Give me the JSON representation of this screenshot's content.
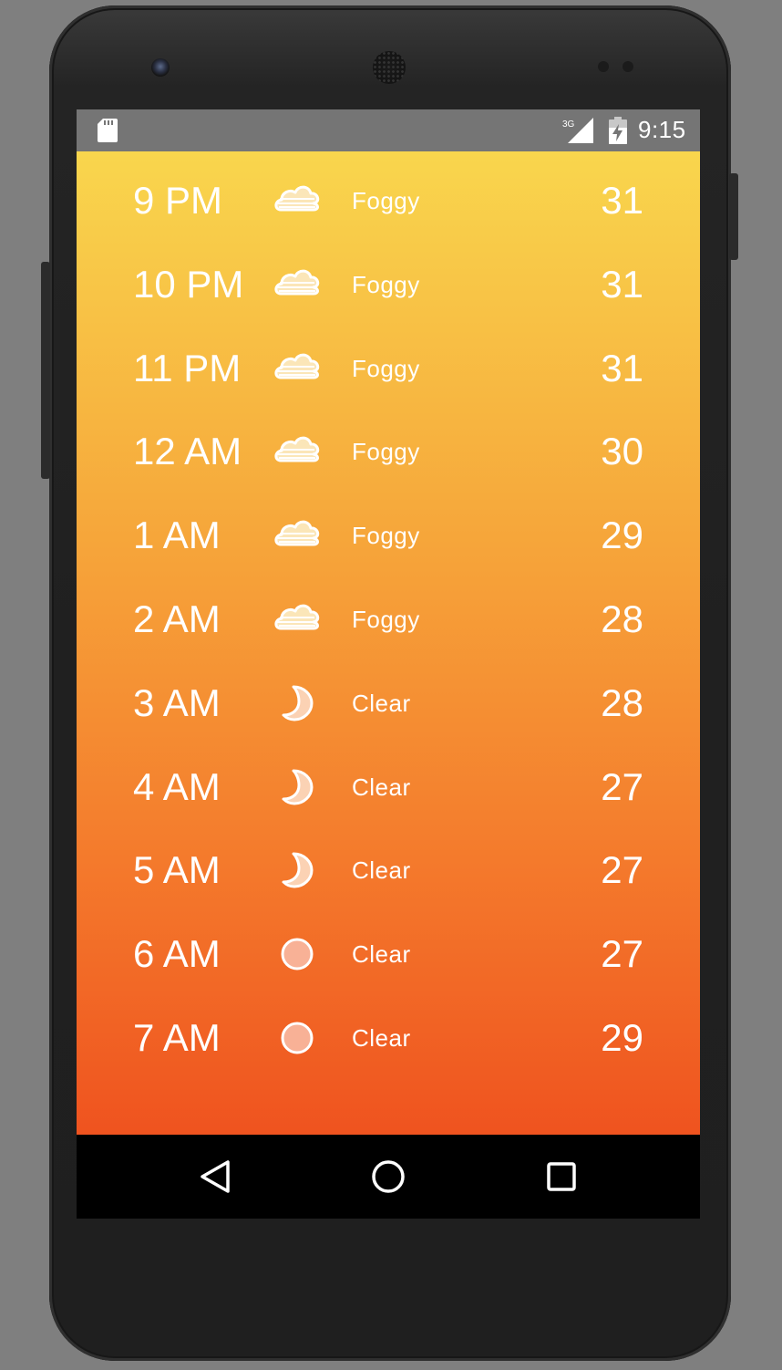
{
  "status_bar": {
    "time": "9:15",
    "network": "3G"
  },
  "colors": {
    "gradient_top": "#f9d64d",
    "gradient_bottom": "#ef531f",
    "status_bar": "#757575",
    "foggy_icon_fill": "#fbe6b8",
    "moon_fill": "#fbd2b4",
    "sun_fill": "#f8b196"
  },
  "hourly": [
    {
      "time": "9 PM",
      "icon": "fog-icon",
      "condition": "Foggy",
      "temp": "31"
    },
    {
      "time": "10 PM",
      "icon": "fog-icon",
      "condition": "Foggy",
      "temp": "31"
    },
    {
      "time": "11 PM",
      "icon": "fog-icon",
      "condition": "Foggy",
      "temp": "31"
    },
    {
      "time": "12 AM",
      "icon": "fog-icon",
      "condition": "Foggy",
      "temp": "30"
    },
    {
      "time": "1 AM",
      "icon": "fog-icon",
      "condition": "Foggy",
      "temp": "29"
    },
    {
      "time": "2 AM",
      "icon": "fog-icon",
      "condition": "Foggy",
      "temp": "28"
    },
    {
      "time": "3 AM",
      "icon": "moon-icon",
      "condition": "Clear",
      "temp": "28"
    },
    {
      "time": "4 AM",
      "icon": "moon-icon",
      "condition": "Clear",
      "temp": "27"
    },
    {
      "time": "5 AM",
      "icon": "moon-icon",
      "condition": "Clear",
      "temp": "27"
    },
    {
      "time": "6 AM",
      "icon": "sun-icon",
      "condition": "Clear",
      "temp": "27"
    },
    {
      "time": "7 AM",
      "icon": "sun-icon",
      "condition": "Clear",
      "temp": "29"
    }
  ],
  "nav_bar": {
    "back_icon": "back-triangle-icon",
    "home_icon": "home-circle-icon",
    "recents_icon": "recents-square-icon"
  }
}
